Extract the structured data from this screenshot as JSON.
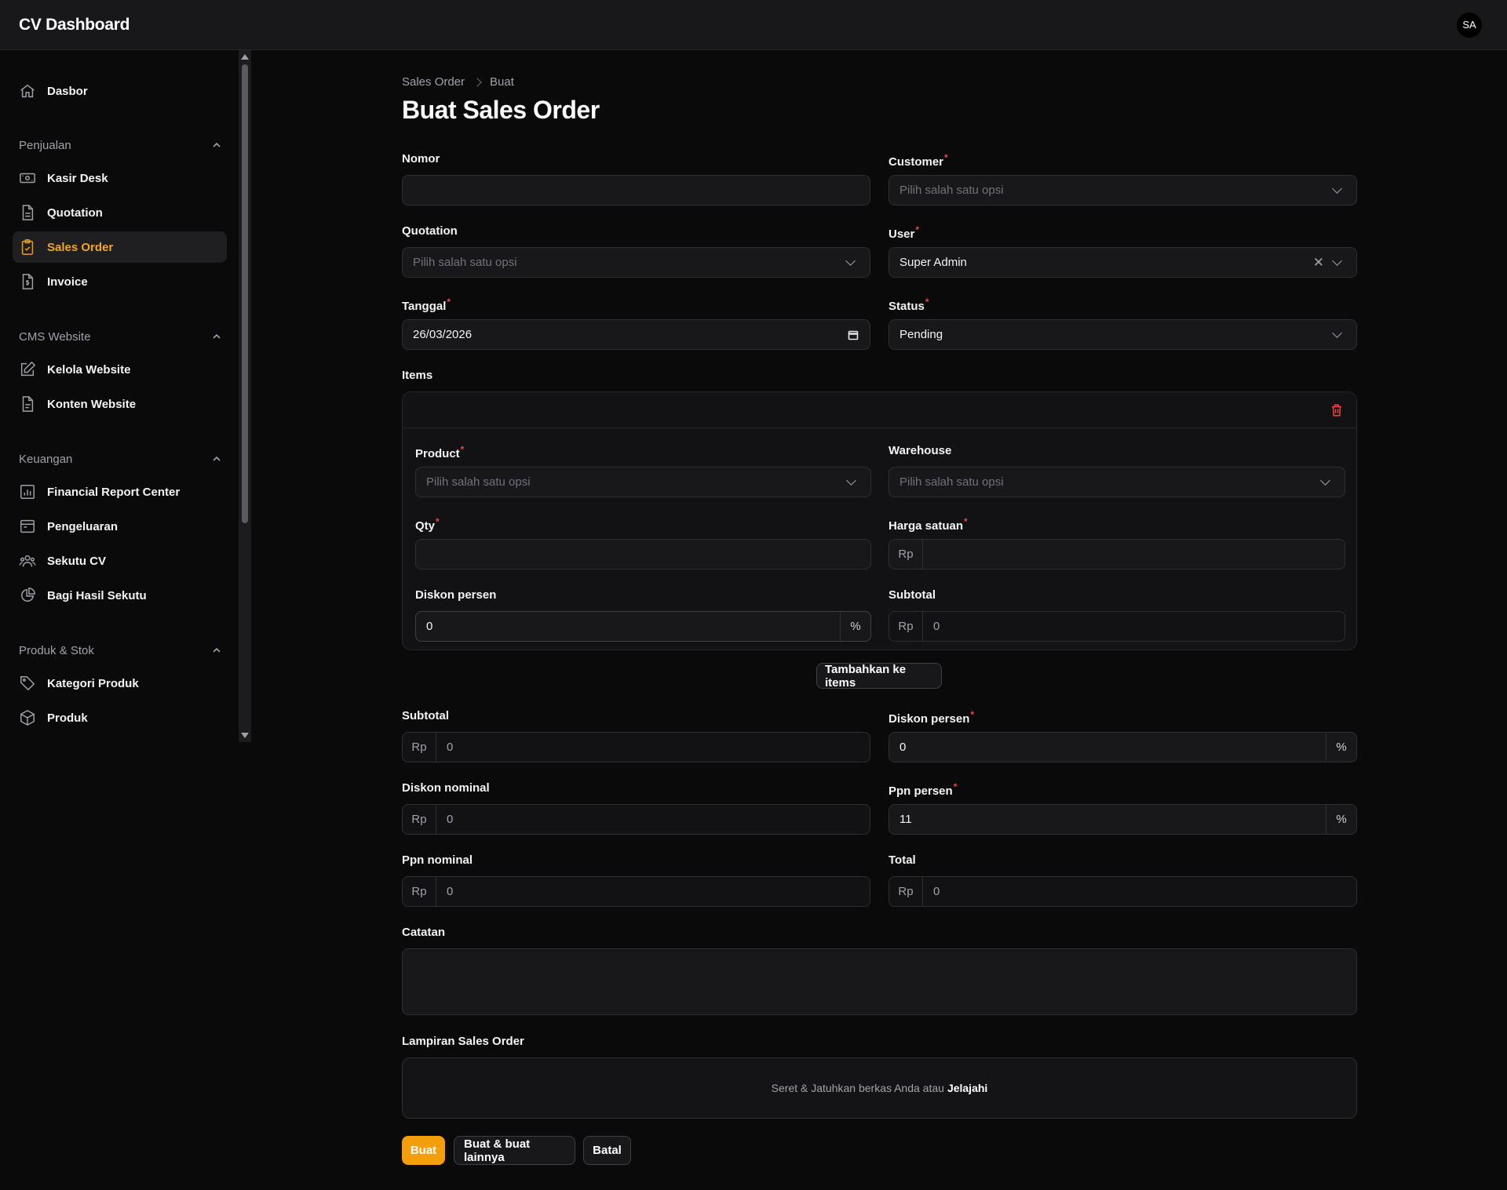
{
  "app": {
    "title": "CV Dashboard",
    "user_initials": "SA"
  },
  "sidebar": {
    "dashboard": "Dasbor",
    "groups": [
      {
        "label": "Penjualan",
        "items": [
          "Kasir Desk",
          "Quotation",
          "Sales Order",
          "Invoice"
        ]
      },
      {
        "label": "CMS Website",
        "items": [
          "Kelola Website",
          "Konten Website"
        ]
      },
      {
        "label": "Keuangan",
        "items": [
          "Financial Report Center",
          "Pengeluaran",
          "Sekutu CV",
          "Bagi Hasil Sekutu"
        ]
      },
      {
        "label": "Produk & Stok",
        "items": [
          "Kategori Produk",
          "Produk"
        ]
      }
    ],
    "active_item": "Sales Order"
  },
  "breadcrumb": [
    "Sales Order",
    "Buat"
  ],
  "page_title": "Buat Sales Order",
  "form": {
    "nomor": {
      "label": "Nomor",
      "value": ""
    },
    "customer": {
      "label": "Customer",
      "placeholder": "Pilih salah satu opsi"
    },
    "quotation": {
      "label": "Quotation",
      "placeholder": "Pilih salah satu opsi"
    },
    "user": {
      "label": "User",
      "value": "Super Admin"
    },
    "tanggal": {
      "label": "Tanggal",
      "value": "26/03/2026"
    },
    "status": {
      "label": "Status",
      "value": "Pending"
    },
    "items_label": "Items",
    "item": {
      "product": {
        "label": "Product",
        "placeholder": "Pilih salah satu opsi"
      },
      "warehouse": {
        "label": "Warehouse",
        "placeholder": "Pilih salah satu opsi"
      },
      "qty": {
        "label": "Qty",
        "value": ""
      },
      "harga_satuan": {
        "label": "Harga satuan",
        "prefix": "Rp",
        "value": ""
      },
      "diskon_persen": {
        "label": "Diskon persen",
        "value": "0",
        "suffix": "%"
      },
      "subtotal": {
        "label": "Subtotal",
        "prefix": "Rp",
        "value": "0"
      }
    },
    "add_item_button": "Tambahkan ke items",
    "subtotal": {
      "label": "Subtotal",
      "prefix": "Rp",
      "value": "0"
    },
    "diskon_persen": {
      "label": "Diskon persen",
      "value": "0",
      "suffix": "%"
    },
    "diskon_nominal": {
      "label": "Diskon nominal",
      "prefix": "Rp",
      "value": "0"
    },
    "ppn_persen": {
      "label": "Ppn persen",
      "value": "11",
      "suffix": "%"
    },
    "ppn_nominal": {
      "label": "Ppn nominal",
      "prefix": "Rp",
      "value": "0"
    },
    "total": {
      "label": "Total",
      "prefix": "Rp",
      "value": "0"
    },
    "catatan": {
      "label": "Catatan",
      "value": ""
    },
    "lampiran": {
      "label": "Lampiran Sales Order",
      "drop_text": "Seret & Jatuhkan berkas Anda atau",
      "browse": "Jelajahi"
    }
  },
  "actions": {
    "create": "Buat",
    "create_another": "Buat & buat lainnya",
    "cancel": "Batal"
  },
  "colors": {
    "accent": "#f59e0b",
    "danger": "#ef4444",
    "background": "#0a0a0b",
    "surface": "#18181b"
  }
}
